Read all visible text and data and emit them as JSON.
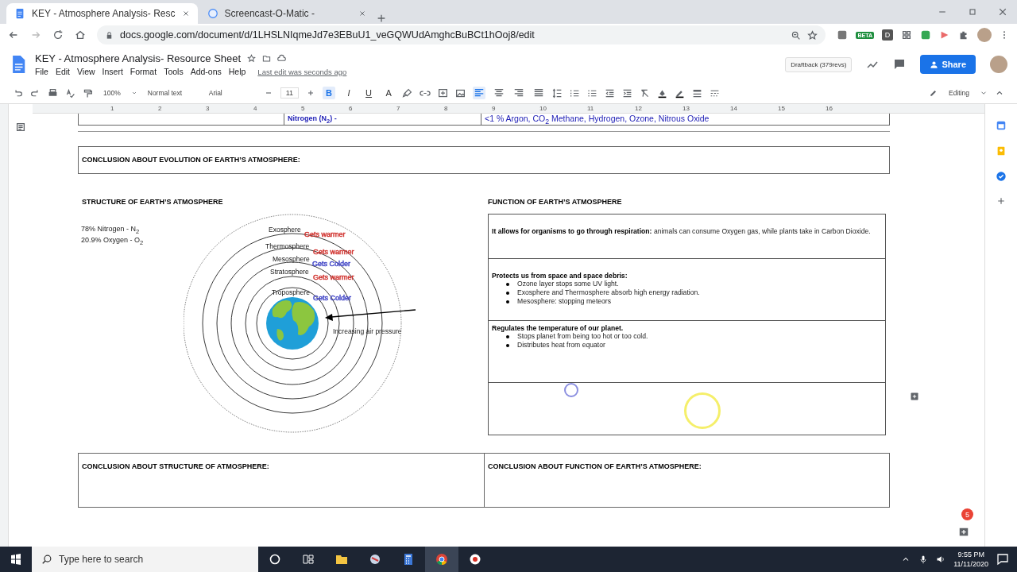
{
  "browser": {
    "tabs": [
      {
        "title": "KEY - Atmosphere Analysis- Resc",
        "selected": true
      },
      {
        "title": "Screencast-O-Matic -",
        "selected": false
      }
    ],
    "url": "docs.google.com/document/d/1LHSLNIqmeJd7e3EBuU1_veGQWUdAmghcBuBCt1hOoj8/edit",
    "extension_badges": [
      "BETA",
      "D"
    ]
  },
  "docs": {
    "title": "KEY - Atmosphere Analysis- Resource Sheet",
    "menus": [
      "File",
      "Edit",
      "View",
      "Insert",
      "Format",
      "Tools",
      "Add-ons",
      "Help"
    ],
    "last_edit": "Last edit was seconds ago",
    "draftback": "Draftback (379revs)",
    "share": "Share"
  },
  "toolbar": {
    "zoom": "100%",
    "style": "Normal text",
    "font": "Arial",
    "size": "11",
    "format_buttons": [
      {
        "label": "B",
        "selected": true
      },
      {
        "label": "I",
        "selected": false
      },
      {
        "label": "U",
        "selected": false
      },
      {
        "label": "A",
        "selected": false
      }
    ],
    "align": [
      {
        "selected": true
      },
      {
        "selected": false
      },
      {
        "selected": false
      },
      {
        "selected": false
      }
    ],
    "mode": "Editing"
  },
  "ruler": [
    "1",
    "2",
    "3",
    "4",
    "5",
    "6",
    "7",
    "8",
    "9",
    "10",
    "11",
    "12",
    "13",
    "14",
    "15",
    "16"
  ],
  "document": {
    "top_row": [
      "Nitrogen (N$_{2}$) -",
      "<1 % Argon, CO$_{2}$ Methane, Hydrogen, Ozone, Nitrous Oxide"
    ],
    "evolution_conclusion": "CONCLUSION ABOUT EVOLUTION OF EARTH’S ATMOSPHERE:",
    "structure": {
      "heading": "STRUCTURE OF EARTH’S ATMOSPHERE",
      "composition": [
        "78% Nitrogen - N$_{2}$",
        "20.9% Oxygen - O$_{2}$"
      ],
      "layers": [
        {
          "name": "Exosphere",
          "note": "Gets warmer",
          "color": "#d0312d"
        },
        {
          "name": "Thermosphere",
          "note": "Gets warmer",
          "color": "#d0312d"
        },
        {
          "name": "Mesosphere",
          "note": "Gets Colder",
          "color": "#3b3fc4"
        },
        {
          "name": "Stratosphere",
          "note": "Gets warmer",
          "color": "#d0312d"
        },
        {
          "name": "Troposphere",
          "note": "Gets Colder",
          "color": "#3b3fc4"
        }
      ],
      "arrow_label": "Increasing air pressure"
    },
    "function": {
      "heading": "FUNCTION OF EARTH’S ATMOSPHERE",
      "rows": [
        {
          "kind": "text",
          "lead": "It allows for organisms to go through respiration:",
          "text": "animals can consume Oxygen gas, while plants take in Carbon Dioxide."
        },
        {
          "kind": "text",
          "lead": "Protects us from space and space debris:",
          "bullets": [
            "Ozone layer stops some UV light.",
            "Exosphere and Thermosphere absorb high energy radiation.",
            "Mesosphere: stopping meteors"
          ]
        },
        {
          "kind": "text",
          "lead": "Regulates the temperature of our planet.",
          "bullets": [
            "Stops planet from being too hot or too cold.",
            "Distributes heat from equator"
          ]
        },
        {
          "kind": "blank"
        }
      ]
    },
    "conclusions": [
      "CONCLUSION ABOUT STRUCTURE OF ATMOSPHERE:",
      "CONCLUSION ABOUT FUNCTION OF EARTH’S ATMOSPHERE:"
    ]
  },
  "comment_badge": "5",
  "taskbar": {
    "search_placeholder": "Type here to search",
    "time": "9:55 PM",
    "date": "11/11/2020"
  }
}
